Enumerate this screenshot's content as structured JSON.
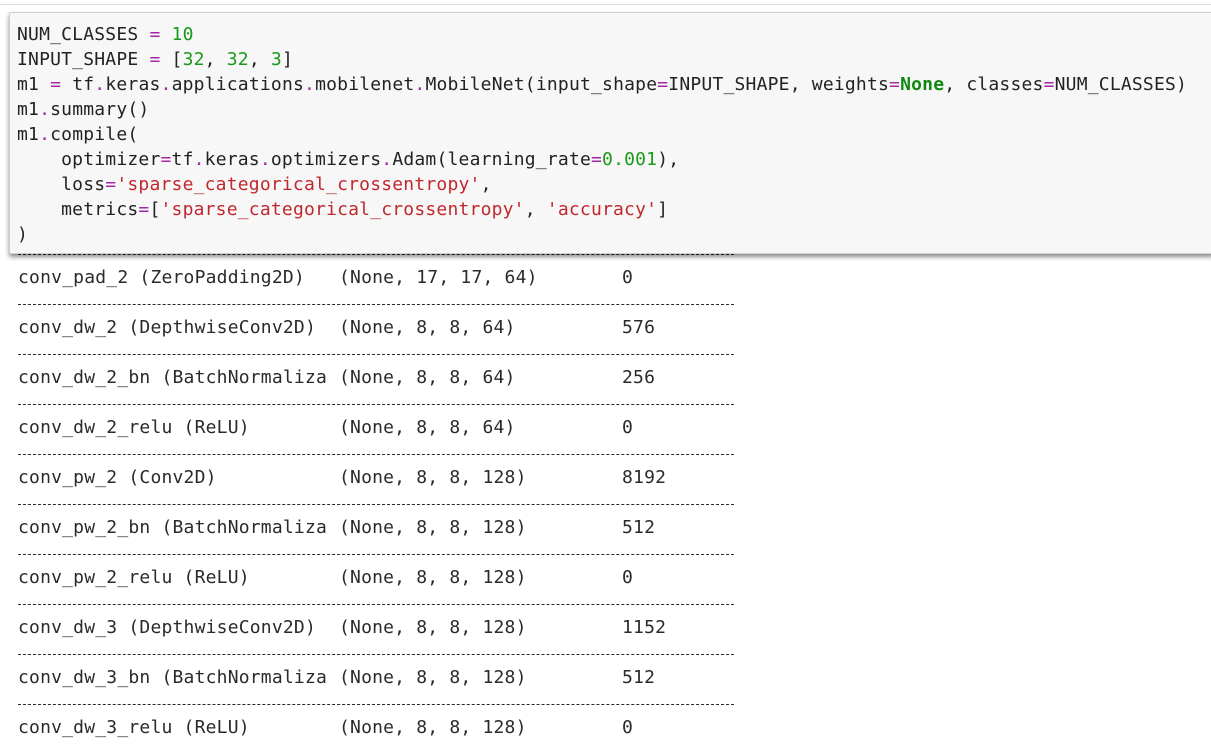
{
  "colors": {
    "background": "#ffffff",
    "code_bg": "#f7f7f7",
    "operator": "#a626a4",
    "number": "#1a9a1a",
    "keyword": "#0f8a0f",
    "string": "#c0282d",
    "text": "#222222"
  },
  "code_cell": {
    "lines": [
      [
        {
          "t": "NUM_CLASSES ",
          "k": "plain"
        },
        {
          "t": "=",
          "k": "op"
        },
        {
          "t": " ",
          "k": "plain"
        },
        {
          "t": "10",
          "k": "num"
        }
      ],
      [
        {
          "t": "INPUT_SHAPE ",
          "k": "plain"
        },
        {
          "t": "=",
          "k": "op"
        },
        {
          "t": " [",
          "k": "plain"
        },
        {
          "t": "32",
          "k": "num"
        },
        {
          "t": ", ",
          "k": "plain"
        },
        {
          "t": "32",
          "k": "num"
        },
        {
          "t": ", ",
          "k": "plain"
        },
        {
          "t": "3",
          "k": "num"
        },
        {
          "t": "]",
          "k": "plain"
        }
      ],
      [
        {
          "t": "m1 ",
          "k": "plain"
        },
        {
          "t": "=",
          "k": "op"
        },
        {
          "t": " tf",
          "k": "plain"
        },
        {
          "t": ".",
          "k": "op"
        },
        {
          "t": "keras",
          "k": "plain"
        },
        {
          "t": ".",
          "k": "op"
        },
        {
          "t": "applications",
          "k": "plain"
        },
        {
          "t": ".",
          "k": "op"
        },
        {
          "t": "mobilenet",
          "k": "plain"
        },
        {
          "t": ".",
          "k": "op"
        },
        {
          "t": "MobileNet(input_shape",
          "k": "plain"
        },
        {
          "t": "=",
          "k": "op"
        },
        {
          "t": "INPUT_SHAPE, weights",
          "k": "plain"
        },
        {
          "t": "=",
          "k": "op"
        },
        {
          "t": "None",
          "k": "kw"
        },
        {
          "t": ", classes",
          "k": "plain"
        },
        {
          "t": "=",
          "k": "op"
        },
        {
          "t": "NUM_CLASSES)",
          "k": "plain"
        }
      ],
      [
        {
          "t": "m1",
          "k": "plain"
        },
        {
          "t": ".",
          "k": "op"
        },
        {
          "t": "summary()",
          "k": "plain"
        }
      ],
      [
        {
          "t": "m1",
          "k": "plain"
        },
        {
          "t": ".",
          "k": "op"
        },
        {
          "t": "compile(",
          "k": "plain"
        }
      ],
      [
        {
          "t": "    optimizer",
          "k": "plain"
        },
        {
          "t": "=",
          "k": "op"
        },
        {
          "t": "tf",
          "k": "plain"
        },
        {
          "t": ".",
          "k": "op"
        },
        {
          "t": "keras",
          "k": "plain"
        },
        {
          "t": ".",
          "k": "op"
        },
        {
          "t": "optimizers",
          "k": "plain"
        },
        {
          "t": ".",
          "k": "op"
        },
        {
          "t": "Adam(learning_rate",
          "k": "plain"
        },
        {
          "t": "=",
          "k": "op"
        },
        {
          "t": "0.001",
          "k": "num"
        },
        {
          "t": "),",
          "k": "plain"
        }
      ],
      [
        {
          "t": "    loss",
          "k": "plain"
        },
        {
          "t": "=",
          "k": "op"
        },
        {
          "t": "'sparse_categorical_crossentropy'",
          "k": "str"
        },
        {
          "t": ",",
          "k": "plain"
        }
      ],
      [
        {
          "t": "    metrics",
          "k": "plain"
        },
        {
          "t": "=",
          "k": "op"
        },
        {
          "t": "[",
          "k": "plain"
        },
        {
          "t": "'sparse_categorical_crossentropy'",
          "k": "str"
        },
        {
          "t": ", ",
          "k": "plain"
        },
        {
          "t": "'accuracy'",
          "k": "str"
        },
        {
          "t": "]",
          "k": "plain"
        }
      ],
      [
        {
          "t": ")",
          "k": "plain"
        }
      ]
    ]
  },
  "output": {
    "rows": [
      {
        "layer": "conv_pad_2 (ZeroPadding2D)",
        "shape": "(None, 17, 17, 64)",
        "params": "0"
      },
      {
        "layer": "conv_dw_2 (DepthwiseConv2D)",
        "shape": "(None, 8, 8, 64)",
        "params": "576"
      },
      {
        "layer": "conv_dw_2_bn (BatchNormaliza",
        "shape": "(None, 8, 8, 64)",
        "params": "256"
      },
      {
        "layer": "conv_dw_2_relu (ReLU)",
        "shape": "(None, 8, 8, 64)",
        "params": "0"
      },
      {
        "layer": "conv_pw_2 (Conv2D)",
        "shape": "(None, 8, 8, 128)",
        "params": "8192"
      },
      {
        "layer": "conv_pw_2_bn (BatchNormaliza",
        "shape": "(None, 8, 8, 128)",
        "params": "512"
      },
      {
        "layer": "conv_pw_2_relu (ReLU)",
        "shape": "(None, 8, 8, 128)",
        "params": "0"
      },
      {
        "layer": "conv_dw_3 (DepthwiseConv2D)",
        "shape": "(None, 8, 8, 128)",
        "params": "1152"
      },
      {
        "layer": "conv_dw_3_bn (BatchNormaliza",
        "shape": "(None, 8, 8, 128)",
        "params": "512"
      },
      {
        "layer": "conv_dw_3_relu (ReLU)",
        "shape": "(None, 8, 8, 128)",
        "params": "0"
      }
    ]
  }
}
